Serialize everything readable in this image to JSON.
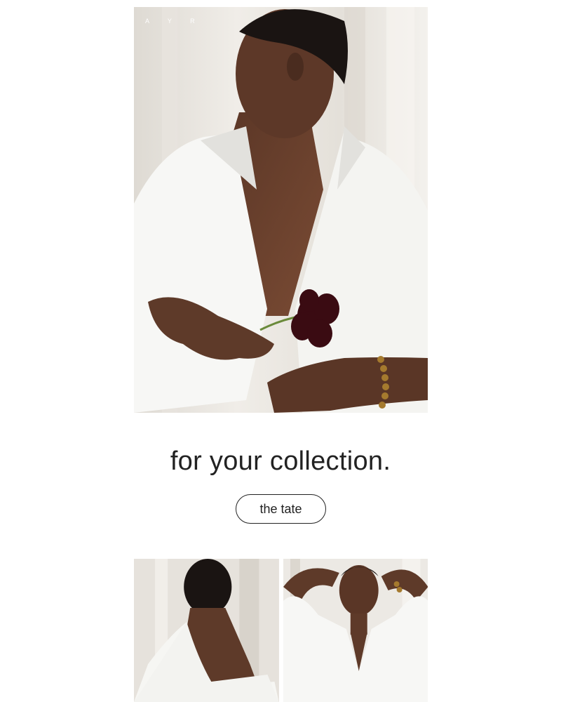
{
  "brand": {
    "logo_text": "A Y R"
  },
  "hero": {
    "image_icon": "model-white-shirt-flower-photo"
  },
  "headline": {
    "text": "for your collection."
  },
  "cta": {
    "label": "the tate"
  },
  "gallery": {
    "images": [
      {
        "icon": "model-back-view-photo"
      },
      {
        "icon": "model-arms-raised-photo"
      }
    ]
  },
  "colors": {
    "text": "#222222",
    "background": "#ffffff",
    "shirt": "#f7f7f5",
    "skin": "#6b4330",
    "flower": "#3a0b12"
  }
}
